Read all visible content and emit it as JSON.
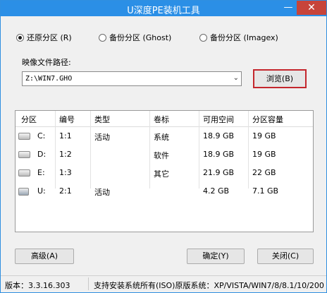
{
  "window": {
    "title": "U深度PE装机工具",
    "minimize_glyph": "—",
    "close_glyph": "✕"
  },
  "modes": [
    {
      "label": "还原分区 (R)",
      "selected": true
    },
    {
      "label": "备份分区 (Ghost)",
      "selected": false
    },
    {
      "label": "备份分区 (Imagex)",
      "selected": false
    }
  ],
  "image_path": {
    "label": "映像文件路径:",
    "value": "Z:\\WIN7.GHO",
    "browse_label": "浏览(B)"
  },
  "table": {
    "headers": [
      "分区",
      "编号",
      "类型",
      "卷标",
      "可用空间",
      "分区容量"
    ],
    "rows": [
      {
        "drive": "C:",
        "number": "1:1",
        "type": "活动",
        "label": "系统",
        "free": "18.9 GB",
        "size": "19 GB",
        "icon": "disk-icon"
      },
      {
        "drive": "D:",
        "number": "1:2",
        "type": "",
        "label": "软件",
        "free": "18.9 GB",
        "size": "19 GB",
        "icon": "disk-icon"
      },
      {
        "drive": "E:",
        "number": "1:3",
        "type": "",
        "label": "其它",
        "free": "21.9 GB",
        "size": "22 GB",
        "icon": "disk-icon"
      },
      {
        "drive": "U:",
        "number": "2:1",
        "type": "活动",
        "label": "",
        "free": "4.2 GB",
        "size": "7.1 GB",
        "icon": "usb-drive-icon"
      }
    ]
  },
  "buttons": {
    "advanced": "高级(A)",
    "ok": "确定(Y)",
    "close": "关闭(C)"
  },
  "status": {
    "version": "版本：3.3.16.303",
    "support": "支持安装系统所有(ISO)原版系统：XP/VISTA/WIN7/8/8.1/10/200"
  },
  "colors": {
    "title_bar": "#2b8fe6",
    "close_button": "#c7443a",
    "browse_highlight": "#c4272d"
  }
}
